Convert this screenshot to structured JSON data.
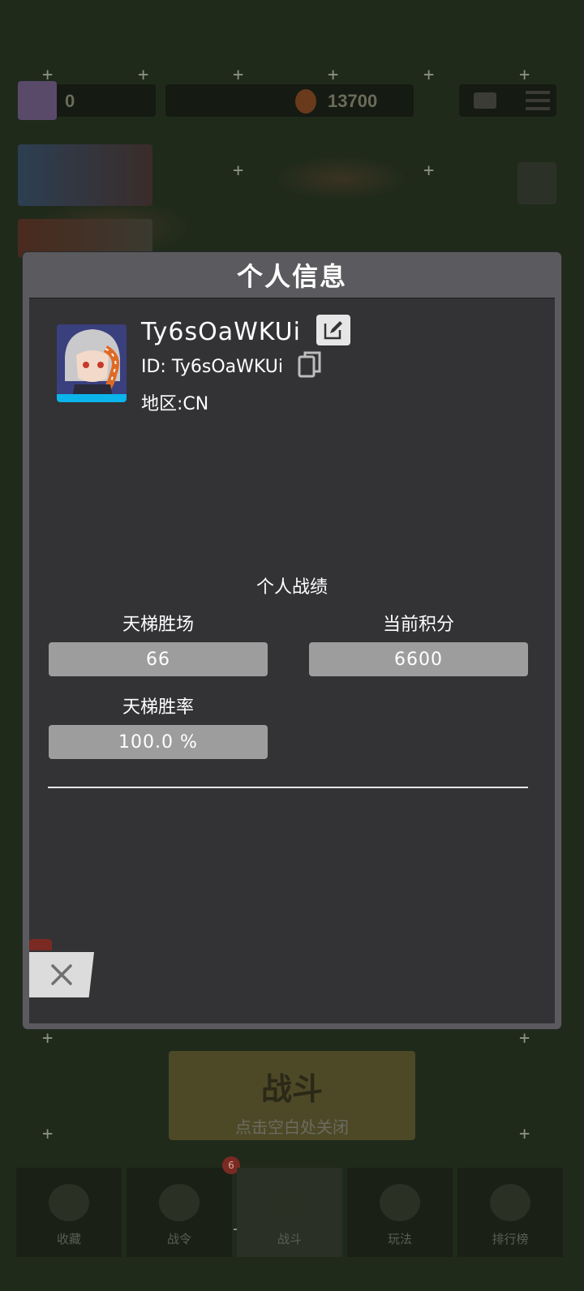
{
  "background": {
    "top_bar": {
      "level_text": "0",
      "currency_value": "13700"
    },
    "fight_button_label": "战斗",
    "close_hint": "点击空白处关闭",
    "bottom_nav": [
      {
        "label": "收藏",
        "icon": "cards-icon"
      },
      {
        "label": "战令",
        "icon": "wings-icon",
        "badge": "6"
      },
      {
        "label": "战斗",
        "icon": "crossed-swords-icon"
      },
      {
        "label": "玩法",
        "icon": "helmet-icon"
      },
      {
        "label": "排行榜",
        "icon": "trophy-icon"
      }
    ]
  },
  "dialog": {
    "title": "个人信息",
    "profile": {
      "username": "Ty6sOaWKUi",
      "id_line": "ID: Ty6sOaWKUi",
      "region": "地区:CN",
      "avatar_stripe_color": "#0bb4ea"
    },
    "stats_title": "个人战绩",
    "stats": [
      {
        "label": "天梯胜场",
        "value": "66"
      },
      {
        "label": "当前积分",
        "value": "6600"
      },
      {
        "label": "天梯胜率",
        "value": "100.0 %"
      }
    ]
  },
  "colors": {
    "dialog_frame": "#5b5b5f",
    "dialog_body": "#333235",
    "stat_box": "#9d9d9d"
  }
}
